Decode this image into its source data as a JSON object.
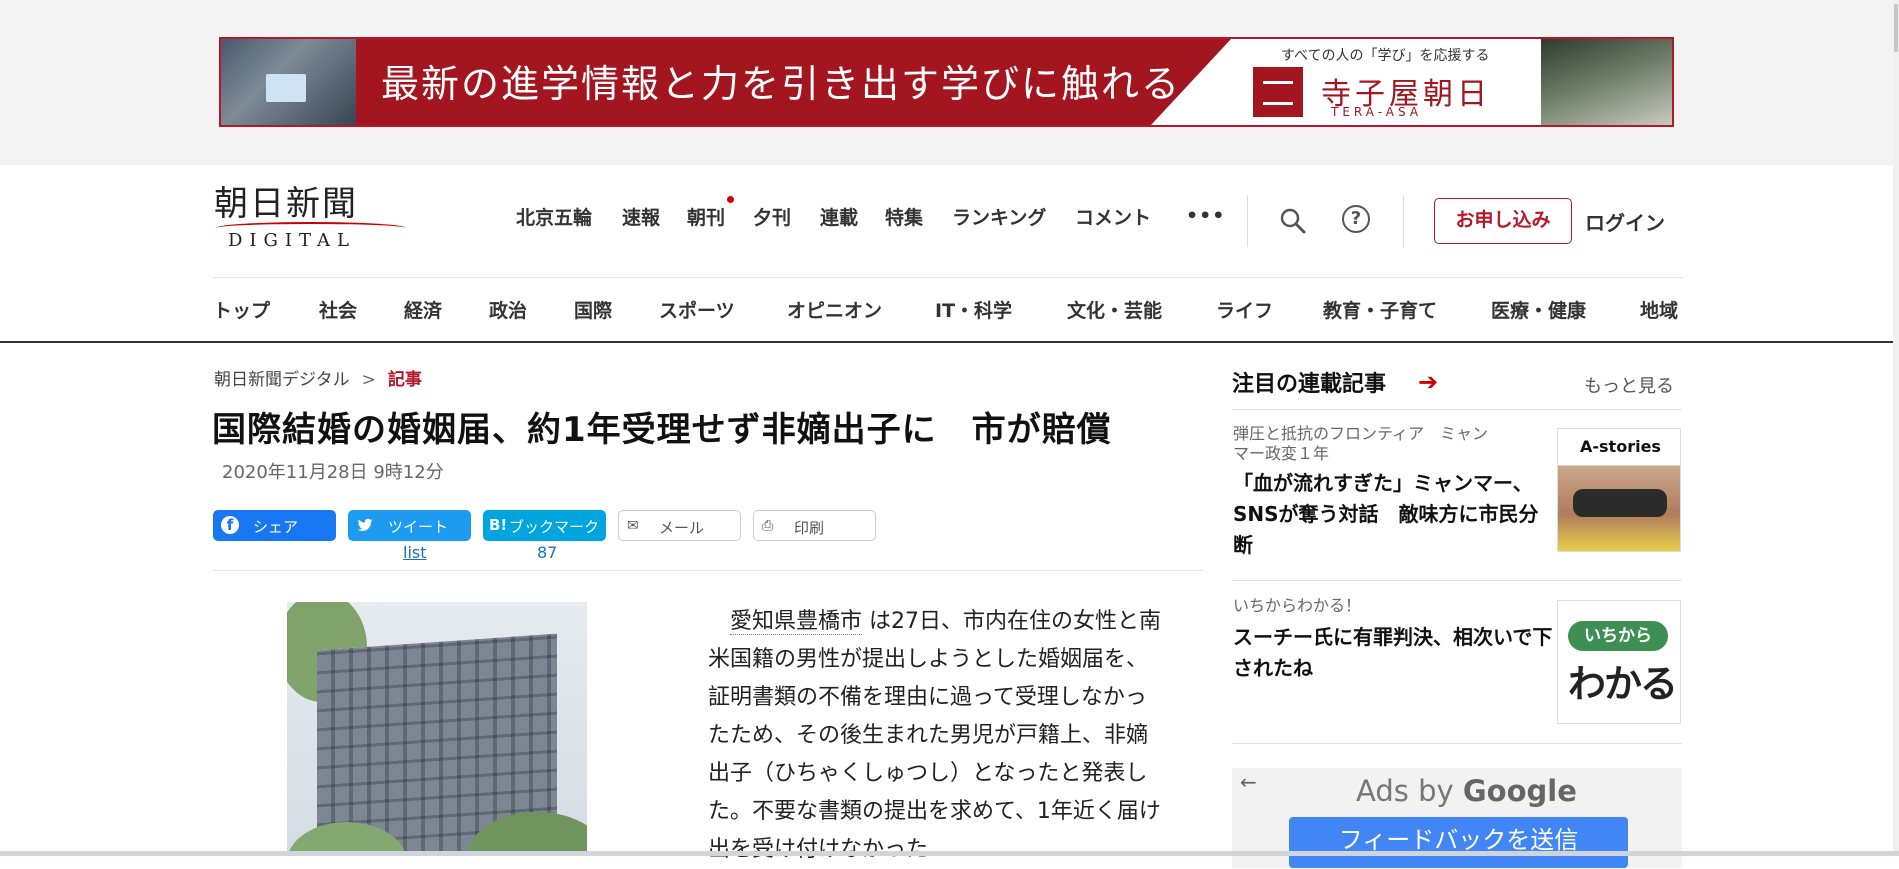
{
  "banner": {
    "headline": "最新の進学情報と力を引き出す学びに触れる",
    "tagline": "すべての人の「学び」を応援する",
    "brand": "寺子屋朝日",
    "brand_en": "TERA-ASA"
  },
  "header": {
    "logo_jp": "朝日新聞",
    "logo_en": "DIGITAL",
    "nav": [
      "北京五輪",
      "速報",
      "朝刊",
      "夕刊",
      "連載",
      "特集",
      "ランキング",
      "コメント"
    ],
    "more_label": "•••",
    "help_label": "?",
    "subscribe_label": "お申し込み",
    "login_label": "ログイン"
  },
  "categories": [
    "トップ",
    "社会",
    "経済",
    "政治",
    "国際",
    "スポーツ",
    "オピニオン",
    "IT・科学",
    "文化・芸能",
    "ライフ",
    "教育・子育て",
    "医療・健康",
    "地域"
  ],
  "breadcrumb": {
    "home": "朝日新聞デジタル",
    "sep": ">",
    "current": "記事"
  },
  "article": {
    "title": "国際結婚の婚姻届、約1年受理せず非嫡出子に　市が賠償",
    "date": "2020年11月28日 9時12分",
    "body_link": "愛知県豊橋市",
    "body_rest": "は27日、市内在住の女性と南米国籍の男性が提出しようとした婚姻届を、証明書類の不備を理由に過って受理しなかったため、その後生まれた男児が戸籍上、非嫡出子（ひちゃくしゅつし）となったと発表した。不要な書類の提出を求めて、1年近く届け出を受け付けなかった"
  },
  "share": {
    "facebook": "シェア",
    "twitter": "ツイート",
    "twitter_count": "list",
    "hatena": "ブックマーク",
    "hatena_icon": "B!",
    "hatena_count": "87",
    "mail": "メール",
    "print": "印刷"
  },
  "sidebar": {
    "heading": "注目の連載記事",
    "more": "もっと見る",
    "items": [
      {
        "kicker": "弾圧と抵抗のフロンティア　ミャンマー政変１年",
        "title": "「血が流れすぎた」ミャンマー、SNSが奪う対話　敵味方に市民分断",
        "thumb_text": "A-stories"
      },
      {
        "kicker": "いちからわかる！",
        "title": "スーチー氏に有罪判決、相次いで下されたね",
        "thumb_pill": "いちから",
        "thumb_big": "わかる",
        "thumb_ex": "!"
      }
    ]
  },
  "ad": {
    "ads_by": "Ads by",
    "google": "Google",
    "feedback": "フィードバックを送信"
  },
  "colors": {
    "brand_red": "#b5172a",
    "banner_red": "#a3151f",
    "facebook": "#1877f2",
    "twitter": "#1d9bf0",
    "hatena": "#00a4de",
    "google_blue": "#4285f4"
  },
  "icons": [
    "search-icon",
    "help-icon",
    "more-icon",
    "facebook-icon",
    "twitter-icon",
    "hatena-icon",
    "mail-icon",
    "print-icon",
    "arrow-right-icon",
    "back-arrow-icon"
  ]
}
